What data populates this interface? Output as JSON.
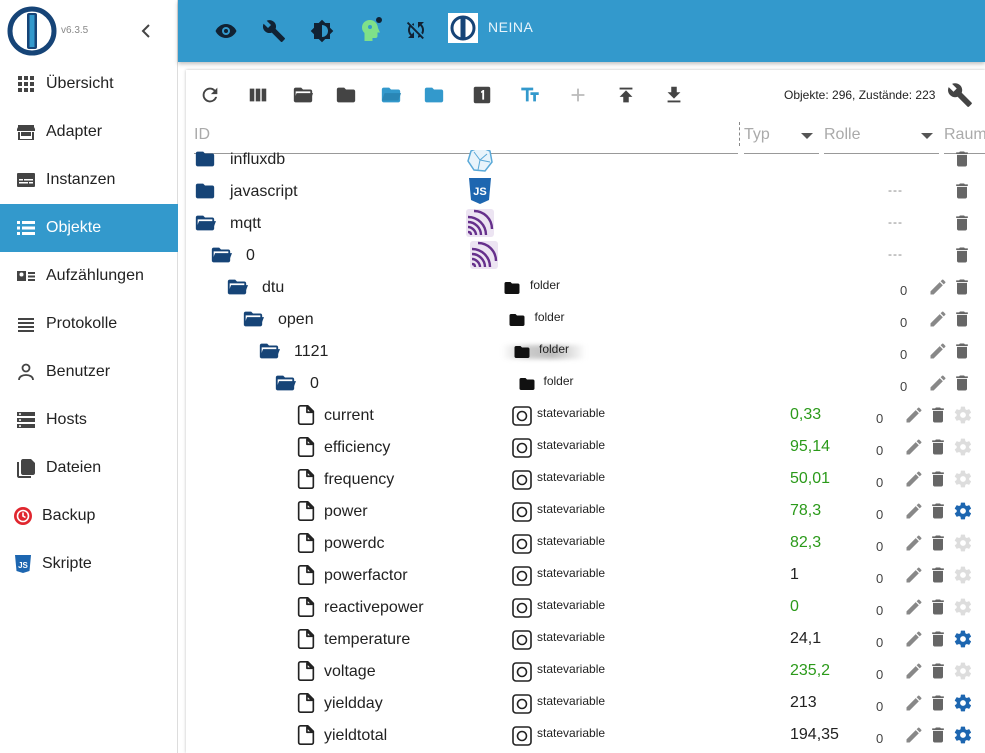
{
  "app": {
    "version": "v6.3.5",
    "host_name": "NEINA"
  },
  "sidebar": {
    "items": [
      {
        "label": "Übersicht",
        "icon": "apps-grid-icon"
      },
      {
        "label": "Adapter",
        "icon": "store-icon"
      },
      {
        "label": "Instanzen",
        "icon": "instances-icon"
      },
      {
        "label": "Objekte",
        "icon": "list-icon",
        "active": true
      },
      {
        "label": "Aufzählungen",
        "icon": "enums-icon"
      },
      {
        "label": "Protokolle",
        "icon": "logs-icon"
      },
      {
        "label": "Benutzer",
        "icon": "user-icon"
      },
      {
        "label": "Hosts",
        "icon": "hosts-icon"
      },
      {
        "label": "Dateien",
        "icon": "files-icon"
      },
      {
        "label": "Backup",
        "icon": "backup-icon"
      },
      {
        "label": "Skripte",
        "icon": "js-icon"
      }
    ]
  },
  "toolbar": {
    "counts": "Objekte: 296, Zustände: 223"
  },
  "filters": {
    "id": "ID",
    "type": "Typ",
    "role": "Rolle",
    "room": "Raum"
  },
  "tree": {
    "rows": [
      {
        "name": "influxdb",
        "kind": "folder-closed",
        "level": 0,
        "adapter": "influxdb",
        "dashes": ""
      },
      {
        "name": "javascript",
        "kind": "folder-closed",
        "level": 0,
        "adapter": "javascript",
        "dashes": "---"
      },
      {
        "name": "mqtt",
        "kind": "folder-open",
        "level": 0,
        "adapter": "mqtt",
        "dashes": "---"
      },
      {
        "name": "0",
        "kind": "folder-open",
        "level": 1,
        "adapter": "mqtt",
        "dashes": "---"
      },
      {
        "name": "dtu",
        "kind": "folder-open",
        "level": 2,
        "type": "folder",
        "zero": "0"
      },
      {
        "name": "open",
        "kind": "folder-open",
        "level": 3,
        "type": "folder",
        "zero": "0"
      },
      {
        "name": "1121",
        "kind": "folder-open",
        "level": 4,
        "type": "folder",
        "zero": "0",
        "blurred": true
      },
      {
        "name": "0",
        "kind": "folder-open",
        "level": 5,
        "type": "folder",
        "zero": "0"
      },
      {
        "name": "current",
        "kind": "file",
        "type": "statevariable",
        "value": "0,33",
        "ack": true,
        "zero": "0",
        "gear": false
      },
      {
        "name": "efficiency",
        "kind": "file",
        "type": "statevariable",
        "value": "95,14",
        "ack": true,
        "zero": "0",
        "gear": false
      },
      {
        "name": "frequency",
        "kind": "file",
        "type": "statevariable",
        "value": "50,01",
        "ack": true,
        "zero": "0",
        "gear": false
      },
      {
        "name": "power",
        "kind": "file",
        "type": "statevariable",
        "value": "78,3",
        "ack": true,
        "zero": "0",
        "gear": true
      },
      {
        "name": "powerdc",
        "kind": "file",
        "type": "statevariable",
        "value": "82,3",
        "ack": true,
        "zero": "0",
        "gear": false
      },
      {
        "name": "powerfactor",
        "kind": "file",
        "type": "statevariable",
        "value": "1",
        "ack": false,
        "zero": "0",
        "gear": false
      },
      {
        "name": "reactivepower",
        "kind": "file",
        "type": "statevariable",
        "value": "0",
        "ack": true,
        "zero": "0",
        "gear": false
      },
      {
        "name": "temperature",
        "kind": "file",
        "type": "statevariable",
        "value": "24,1",
        "ack": false,
        "zero": "0",
        "gear": true
      },
      {
        "name": "voltage",
        "kind": "file",
        "type": "statevariable",
        "value": "235,2",
        "ack": true,
        "zero": "0",
        "gear": false
      },
      {
        "name": "yieldday",
        "kind": "file",
        "type": "statevariable",
        "value": "213",
        "ack": false,
        "zero": "0",
        "gear": true
      },
      {
        "name": "yieldtotal",
        "kind": "file",
        "type": "statevariable",
        "value": "194,35",
        "ack": false,
        "zero": "0",
        "gear": true
      }
    ]
  },
  "colors": {
    "accent": "#3399cc",
    "ack_value": "#2b9a1a",
    "folder": "#164477"
  }
}
